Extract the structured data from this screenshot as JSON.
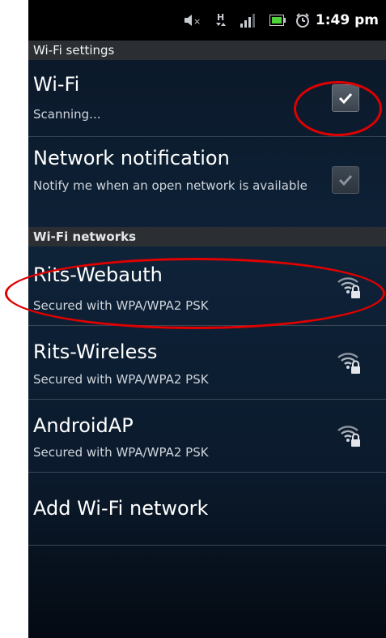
{
  "status_bar": {
    "time": "1:49 pm",
    "icons": [
      "mute-icon",
      "hspa-icon",
      "signal-icon",
      "battery-icon",
      "alarm-icon"
    ]
  },
  "title": "Wi-Fi settings",
  "wifi": {
    "title": "Wi-Fi",
    "summary": "Scanning...",
    "checked": true
  },
  "network_notification": {
    "title": "Network notification",
    "summary": "Notify me when an open network is available",
    "checked": true
  },
  "networks_header": "Wi-Fi networks",
  "networks": [
    {
      "ssid": "Rits-Webauth",
      "security": "Secured with WPA/WPA2 PSK",
      "icon": "wifi-locked-icon"
    },
    {
      "ssid": "Rits-Wireless",
      "security": "Secured with WPA/WPA2 PSK",
      "icon": "wifi-locked-icon"
    },
    {
      "ssid": "AndroidAP",
      "security": "Secured with WPA/WPA2 PSK",
      "icon": "wifi-locked-icon"
    }
  ],
  "add_network": "Add Wi-Fi network",
  "colors": {
    "annotation": "#e00000",
    "background_top": "#0a1625",
    "background_bottom": "#040a12"
  }
}
